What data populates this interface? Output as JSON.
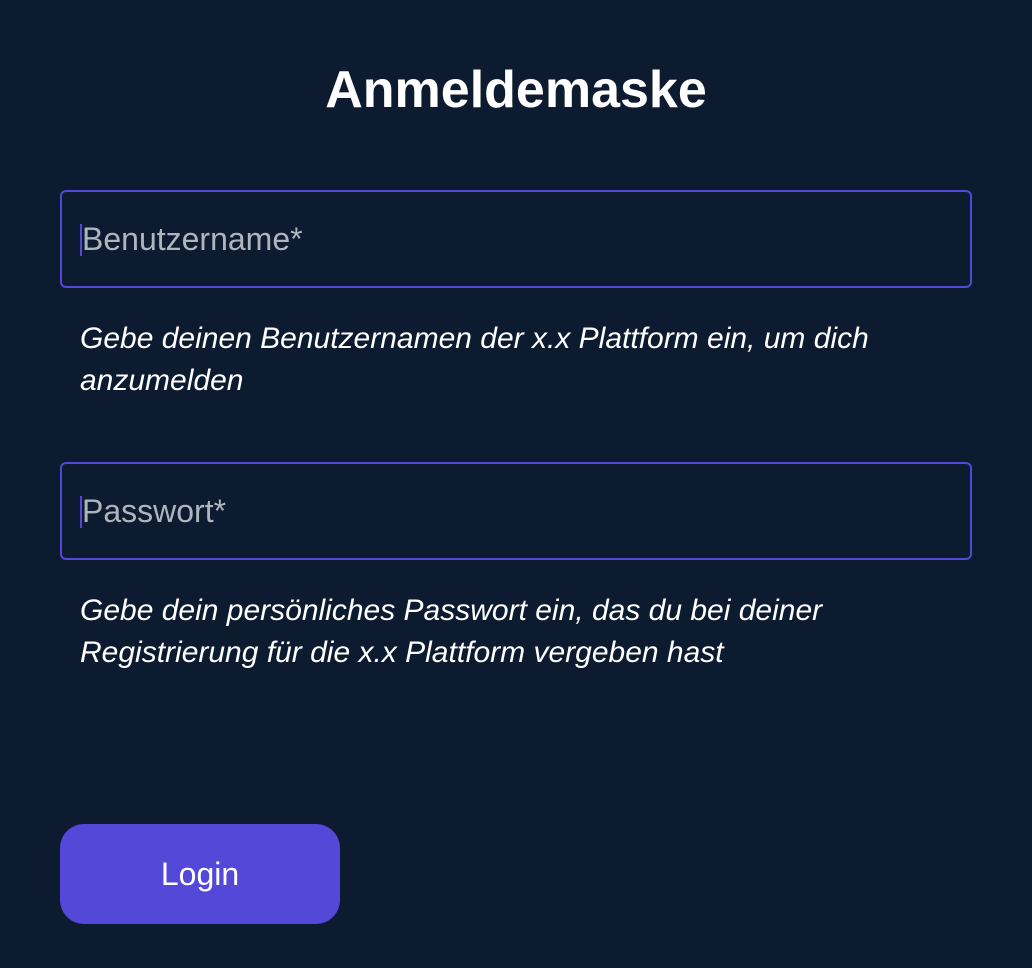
{
  "title": "Anmeldemaske",
  "form": {
    "username": {
      "placeholder": "Benutzername*",
      "value": "",
      "help": "Gebe deinen Benutzernamen der x.x Plattform ein, um dich anzumelden"
    },
    "password": {
      "placeholder": "Passwort*",
      "value": "",
      "help": "Gebe dein persönliches Passwort ein, das du bei deiner Registrierung für die x.x Plattform vergeben hast"
    },
    "submit_label": "Login"
  }
}
